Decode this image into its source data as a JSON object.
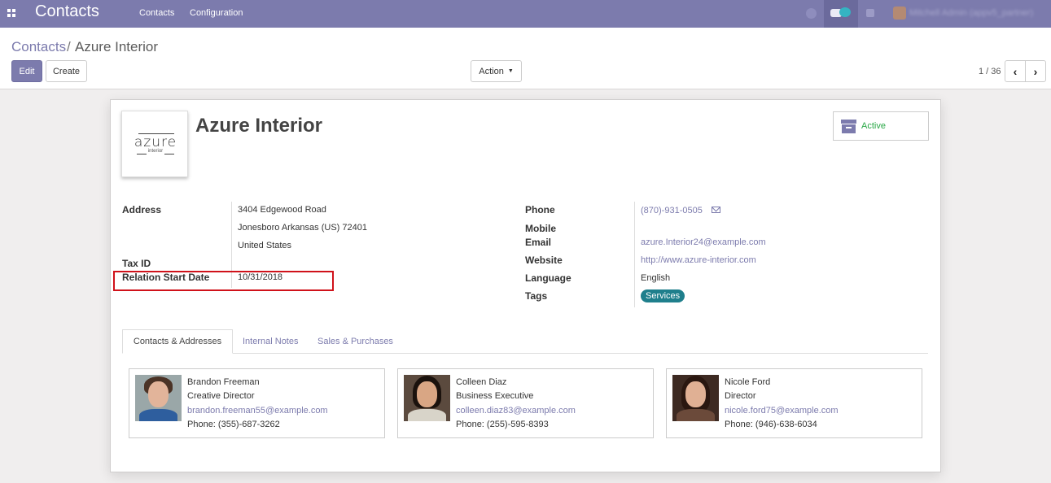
{
  "navbar": {
    "app_name": "Contacts",
    "menu": [
      "Contacts",
      "Configuration"
    ],
    "user_name": "Mitchell Admin (appv5_partner)"
  },
  "breadcrumb": {
    "root": "Contacts",
    "separator": "/",
    "current": "Azure Interior"
  },
  "toolbar": {
    "edit_label": "Edit",
    "create_label": "Create",
    "action_label": "Action"
  },
  "pager": {
    "value": "1 / 36"
  },
  "record": {
    "name": "Azure Interior",
    "logo_text": "azure",
    "logo_subtext": "interior",
    "status_button": "Active",
    "left_fields": {
      "address_label": "Address",
      "street": "3404 Edgewood Road",
      "city_line": "Jonesboro  Arkansas (US)  72401",
      "country": "United States",
      "tax_id_label": "Tax ID",
      "relation_start_label": "Relation Start Date",
      "relation_start_value": "10/31/2018"
    },
    "right_fields": {
      "phone_label": "Phone",
      "phone_value": "(870)-931-0505",
      "mobile_label": "Mobile",
      "email_label": "Email",
      "email_value": "azure.Interior24@example.com",
      "website_label": "Website",
      "website_value": "http://www.azure-interior.com",
      "language_label": "Language",
      "language_value": "English",
      "tags_label": "Tags",
      "tag_value": "Services"
    }
  },
  "tabs": [
    "Contacts & Addresses",
    "Internal Notes",
    "Sales & Purchases"
  ],
  "contacts": [
    {
      "name": "Brandon Freeman",
      "role": "Creative Director",
      "email": "brandon.freeman55@example.com",
      "phone": "Phone: (355)-687-3262"
    },
    {
      "name": "Colleen Diaz",
      "role": "Business Executive",
      "email": "colleen.diaz83@example.com",
      "phone": "Phone: (255)-595-8393"
    },
    {
      "name": "Nicole Ford",
      "role": "Director",
      "email": "nicole.ford75@example.com",
      "phone": "Phone: (946)-638-6034"
    }
  ],
  "colors": {
    "brand": "#7c7bad",
    "active_status": "#28a745",
    "tag": "#1f7f8c",
    "highlight": "#d0121a"
  }
}
